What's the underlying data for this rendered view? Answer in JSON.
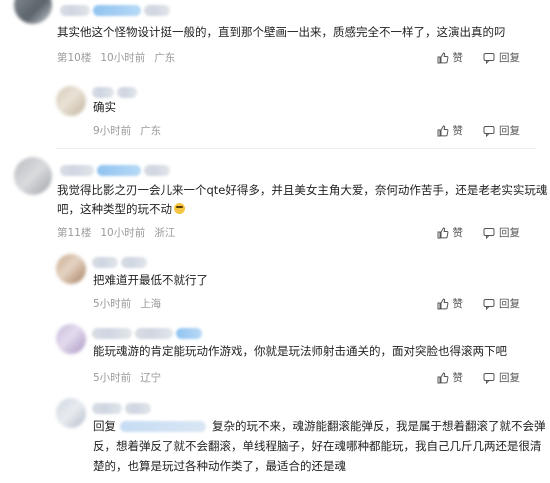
{
  "actions": {
    "like_label": "赞",
    "reply_label": "回复"
  },
  "comments": [
    {
      "text": "其实他这个怪物设计挺一般的，直到那个壁画一出来，质感完全不一样了，这演出真的叼",
      "floor": "第10楼",
      "time": "10小时前",
      "location": "广东"
    },
    {
      "text": "确实",
      "time": "9小时前",
      "location": "广东"
    },
    {
      "text_line1": "我觉得比影之刃一会儿来一个qte好得多，并且美女主角大爱，奈何动作苦手，还是老老实实玩魂",
      "text_line2": "吧，这种类型的玩不动",
      "floor": "第11楼",
      "time": "10小时前",
      "location": "浙江"
    },
    {
      "text": "把难道开最低不就行了",
      "time": "5小时前",
      "location": "上海"
    },
    {
      "text": "能玩魂游的肯定能玩动作游戏，你就是玩法师射击通关的，面对突脸也得滚两下吧",
      "time": "5小时前",
      "location": "辽宁"
    },
    {
      "reply_prefix": "回复",
      "text_line1": "复杂的玩不来，魂游能翻滚能弹反，我是属于想着翻滚了就不会弹",
      "text_line2": "反，想着弹反了就不会翻滚，单线程脑子，好在魂哪种都能玩，我自己几斤几两还是很清",
      "text_line3": "楚的，也算是玩过各种动作类了，最适合的还是魂"
    }
  ]
}
